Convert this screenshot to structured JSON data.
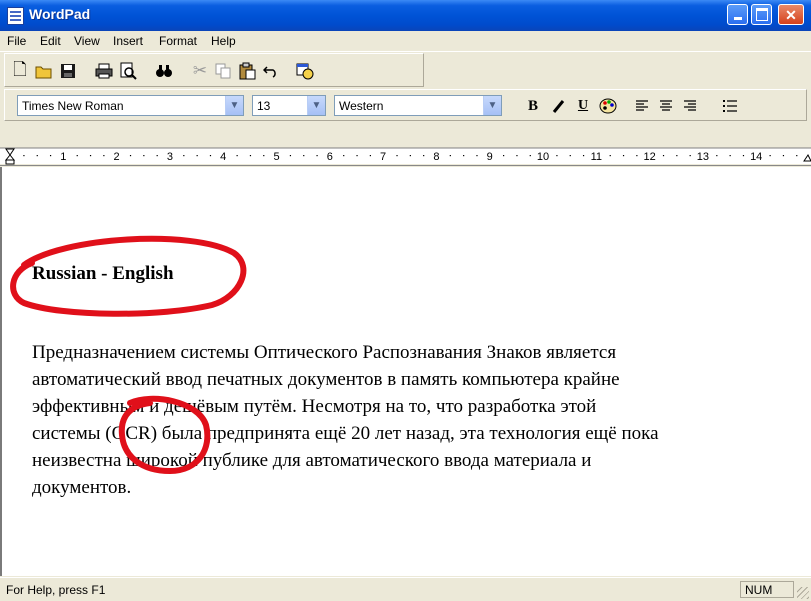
{
  "window": {
    "title": "WordPad",
    "icon": "wordpad-icon"
  },
  "menu": [
    "File",
    "Edit",
    "View",
    "Insert",
    "Format",
    "Help"
  ],
  "toolbar": {
    "buttons": [
      "new-document-icon",
      "open-folder-icon",
      "save-disk-icon",
      "print-icon",
      "print-preview-icon",
      "find-binoculars-icon",
      "cut-icon",
      "copy-icon",
      "paste-icon",
      "undo-icon",
      "insert-date-time-icon"
    ]
  },
  "format": {
    "font": "Times New Roman",
    "size": "13",
    "script": "Western",
    "bold": "B",
    "underline": "U"
  },
  "ruler": {
    "ticks": [
      "1",
      "2",
      "3",
      "4",
      "5",
      "6",
      "7",
      "8",
      "9",
      "10",
      "11",
      "12",
      "13",
      "14"
    ]
  },
  "document": {
    "heading": "Russian - English",
    "paragraph_lines": [
      "Предназначением системы Оптического Распознавания Знаков является",
      "автоматический ввод печатных документов в память компьютера крайне",
      "эффективным и дешёвым путём. Несмотря на то, что разработка этой",
      "системы (OCR) была предпринята ещё 20 лет назад, эта технология ещё пока",
      "неизвестна широкой публике для автоматического ввода материала и",
      "документов."
    ],
    "annotation_color": "#e0101a"
  },
  "status": {
    "help": "For Help, press F1",
    "num": "NUM"
  }
}
